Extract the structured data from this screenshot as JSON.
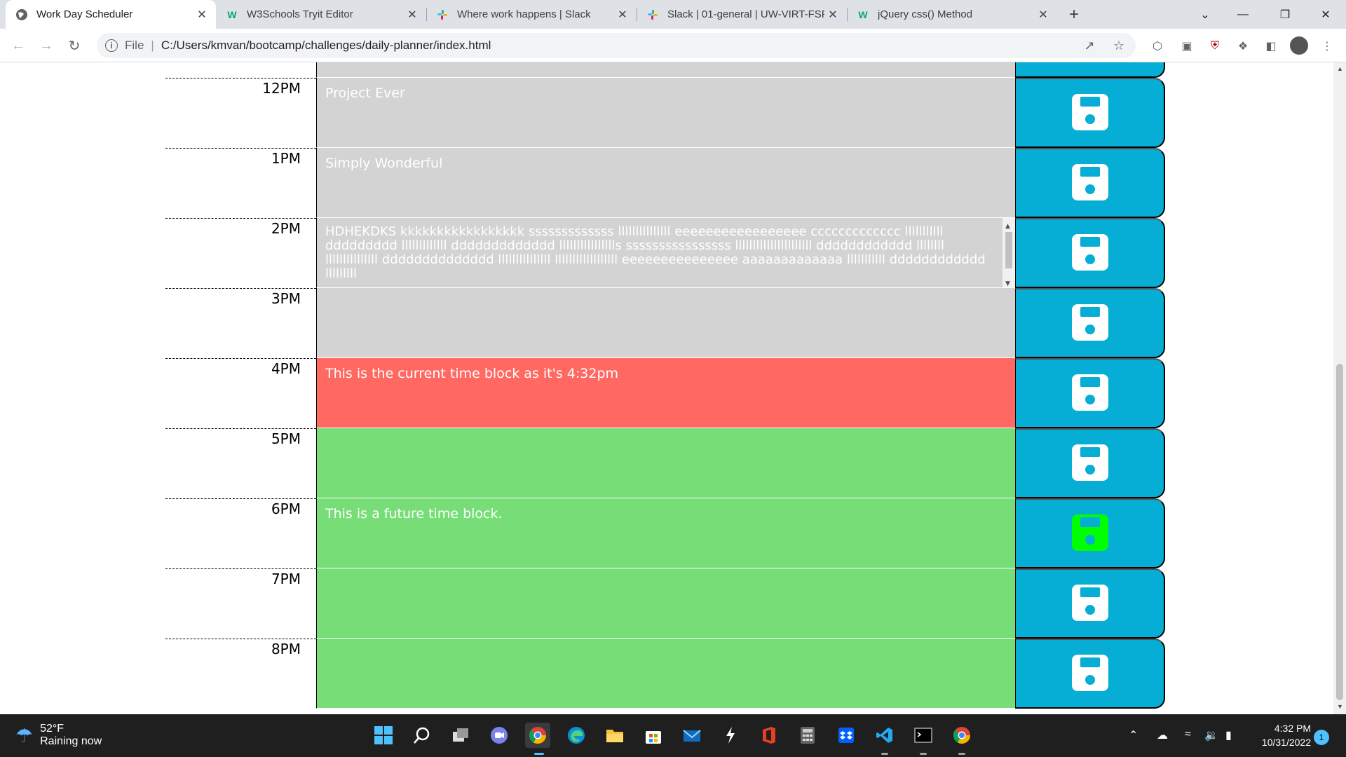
{
  "browser": {
    "tabs": [
      {
        "title": "Work Day Scheduler",
        "icon": "globe-icon",
        "active": true
      },
      {
        "title": "W3Schools Tryit Editor",
        "icon": "w3schools-icon",
        "active": false
      },
      {
        "title": "Where work happens | Slack",
        "icon": "slack-icon",
        "active": false
      },
      {
        "title": "Slack | 01-general | UW-VIRT-FSF",
        "icon": "slack-icon",
        "active": false
      },
      {
        "title": "jQuery css() Method",
        "icon": "w3schools-icon",
        "active": false
      }
    ],
    "close_glyph": "✕",
    "new_tab_glyph": "+",
    "address": {
      "scheme_label": "File",
      "url": "C:/Users/kmvan/bootcamp/challenges/daily-planner/index.html"
    },
    "window_controls": {
      "dropdown": "⌄",
      "minimize": "—",
      "restore": "❐",
      "close": "✕"
    }
  },
  "scheduler": {
    "accent_colors": {
      "past": "#d3d3d3",
      "present": "#ff6961",
      "future": "#77dd77",
      "save": "#06aed5",
      "save_active_icon": "#00ff00"
    },
    "blocks": [
      {
        "hour": "",
        "text": "",
        "state": "past"
      },
      {
        "hour": "12PM",
        "text": "Project Ever",
        "state": "past"
      },
      {
        "hour": "1PM",
        "text": "Simply Wonderful",
        "state": "past"
      },
      {
        "hour": "2PM",
        "text": "HDHEKDKS kkkkkkkkkkkkkkkkk sssssssssssss lllllllllllllll eeeeeeeeeeeeeeeee ccccccccccccc lllllllllll ddddddddd lllllllllllll ddddddddddddd lllllllllllllllls ssssssssssssssss llllllllllllllllllllll dddddddddddd llllllll lllllllllllllll dddddddddddddd lllllllllllllll llllllllllllllllll eeeeeeeeeeeeeee aaaaaaaaaaaaa lllllllllll dddddddddddd lllllllll",
        "state": "past"
      },
      {
        "hour": "3PM",
        "text": "",
        "state": "past"
      },
      {
        "hour": "4PM",
        "text": "This is the current time block as it's 4:32pm",
        "state": "present"
      },
      {
        "hour": "5PM",
        "text": "",
        "state": "future"
      },
      {
        "hour": "6PM",
        "text": "This is a future time block.",
        "state": "future"
      },
      {
        "hour": "7PM",
        "text": "",
        "state": "future"
      },
      {
        "hour": "8PM",
        "text": "",
        "state": "future"
      }
    ]
  },
  "taskbar": {
    "weather": {
      "temp": "52°F",
      "condition": "Raining now"
    },
    "clock": {
      "time": "4:32 PM",
      "date": "10/31/2022"
    },
    "notification_count": "1"
  }
}
